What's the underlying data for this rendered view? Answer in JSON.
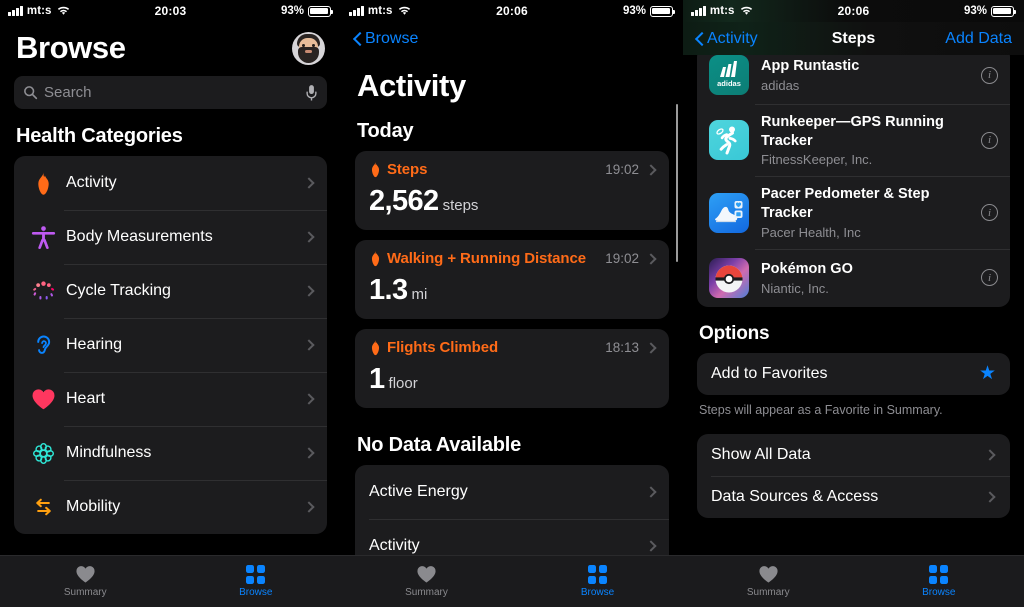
{
  "screens": [
    {
      "id": "browse",
      "status": {
        "carrier": "mt:s",
        "time": "20:03",
        "battery_pct": "93%"
      },
      "title": "Browse",
      "search": {
        "value": "",
        "placeholder": "Search"
      },
      "section_title": "Health Categories",
      "categories": [
        {
          "label": "Activity",
          "icon": "flame-icon",
          "color": "#ff6b18"
        },
        {
          "label": "Body Measurements",
          "icon": "body-icon",
          "color": "#bf5af2"
        },
        {
          "label": "Cycle Tracking",
          "icon": "cycle-icon",
          "color": "#ff6482"
        },
        {
          "label": "Hearing",
          "icon": "ear-icon",
          "color": "#0a84ff"
        },
        {
          "label": "Heart",
          "icon": "heart-icon",
          "color": "#ff375f"
        },
        {
          "label": "Mindfulness",
          "icon": "mindfulness-icon",
          "color": "#2ee6d6"
        },
        {
          "label": "Mobility",
          "icon": "mobility-arrows-icon",
          "color": "#ffa010"
        }
      ],
      "tabs": [
        {
          "label": "Summary",
          "icon": "heart-icon",
          "active": false
        },
        {
          "label": "Browse",
          "icon": "grid-icon",
          "active": true
        }
      ]
    },
    {
      "id": "activity",
      "status": {
        "carrier": "mt:s",
        "time": "20:06",
        "battery_pct": "93%"
      },
      "nav": {
        "back_label": "Browse",
        "title": "",
        "right_label": ""
      },
      "title": "Activity",
      "today_header": "Today",
      "today_cards": [
        {
          "name": "Steps",
          "time": "19:02",
          "value": "2,562",
          "unit": "steps"
        },
        {
          "name": "Walking + Running Distance",
          "time": "19:02",
          "value": "1.3",
          "unit": "mi"
        },
        {
          "name": "Flights Climbed",
          "time": "18:13",
          "value": "1",
          "unit": "floor"
        }
      ],
      "nodata_header": "No Data Available",
      "nodata_rows": [
        {
          "label": "Active Energy"
        },
        {
          "label": "Activity"
        }
      ],
      "tabs": [
        {
          "label": "Summary",
          "icon": "heart-icon",
          "active": false
        },
        {
          "label": "Browse",
          "icon": "grid-icon",
          "active": true
        }
      ]
    },
    {
      "id": "steps",
      "status": {
        "carrier": "mt:s",
        "time": "20:06",
        "battery_pct": "93%"
      },
      "nav": {
        "back_label": "Activity",
        "title": "Steps",
        "right_label": "Add Data"
      },
      "apps": [
        {
          "name": "App Runtastic",
          "developer": "adidas",
          "icon": "adidas-app-icon"
        },
        {
          "name": "Runkeeper—GPS Running Tracker",
          "developer": "FitnessKeeper, Inc.",
          "icon": "runkeeper-app-icon"
        },
        {
          "name": "Pacer Pedometer & Step Tracker",
          "developer": "Pacer Health, Inc",
          "icon": "pacer-app-icon"
        },
        {
          "name": "Pokémon GO",
          "developer": "Niantic, Inc.",
          "icon": "pokemon-go-app-icon"
        }
      ],
      "options_header": "Options",
      "favorite_row": {
        "label": "Add to Favorites",
        "icon": "star-icon"
      },
      "favorite_footnote": "Steps will appear as a Favorite in Summary.",
      "data_rows": [
        {
          "label": "Show All Data"
        },
        {
          "label": "Data Sources & Access"
        }
      ],
      "tabs": [
        {
          "label": "Summary",
          "icon": "heart-icon",
          "active": false
        },
        {
          "label": "Browse",
          "icon": "grid-icon",
          "active": true
        }
      ]
    }
  ],
  "colors": {
    "accent_blue": "#0a84ff",
    "accent_orange": "#ff6b18",
    "card_bg": "#1c1c1e",
    "page_bg": "#000000",
    "secondary_text": "#8e8e93"
  }
}
